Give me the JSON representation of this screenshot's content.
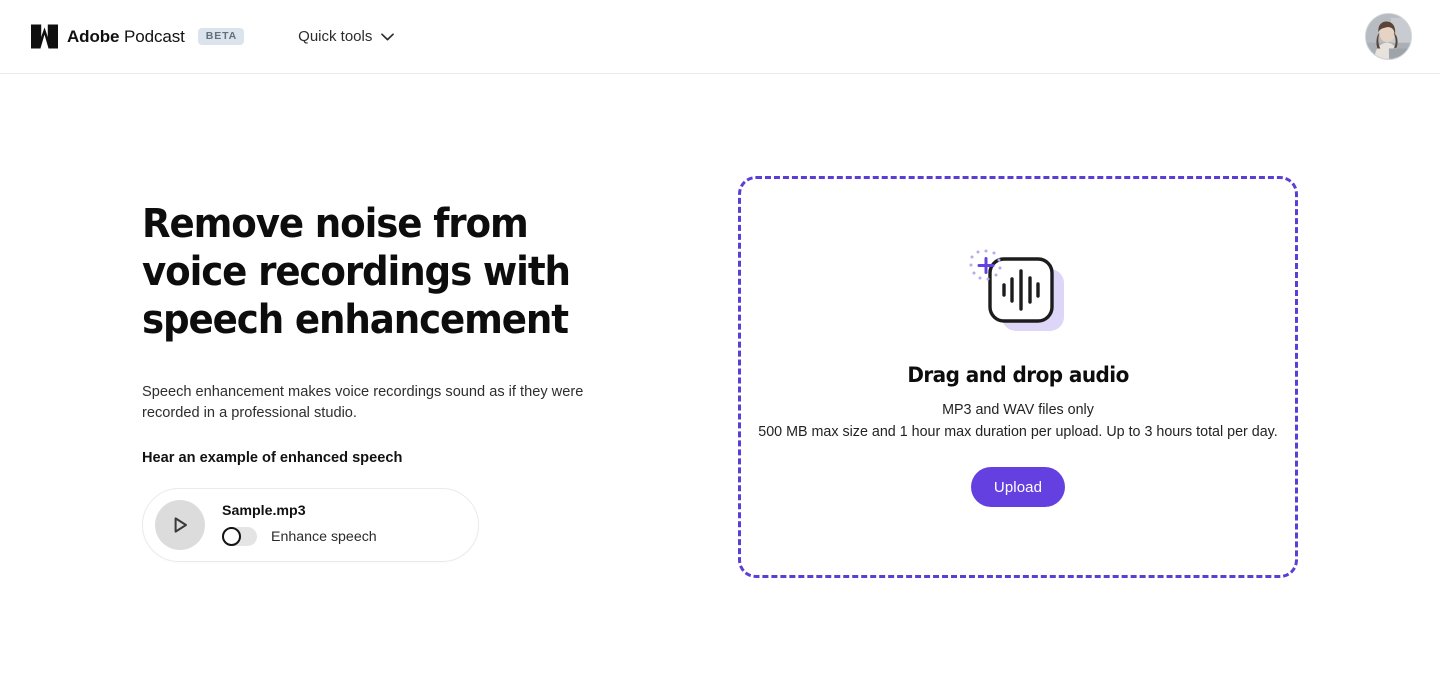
{
  "header": {
    "logo_icon": "adobe-a-logo",
    "brand_bold": "Adobe",
    "brand_regular": " Podcast",
    "beta_badge": "BETA",
    "quick_tools_label": "Quick tools",
    "chevron_icon": "chevron-down-icon",
    "avatar_icon": "user-avatar-photo"
  },
  "hero": {
    "headline": "Remove noise from\nvoice recordings with\nspeech enhancement",
    "subcopy": "Speech enhancement makes voice recordings sound as if they were recorded in a professional studio.",
    "hear_example_label": "Hear an example of enhanced speech"
  },
  "sample_player": {
    "play_icon": "play-icon",
    "file_name": "Sample.mp3",
    "toggle_label": "Enhance speech",
    "toggle_state": "off"
  },
  "dropzone": {
    "icon": "audio-file-add-icon",
    "title": "Drag and drop audio",
    "sub_line_1": "MP3 and WAV files only",
    "sub_line_2": "500 MB max size and 1 hour max duration per upload. Up to 3 hours total per day.",
    "upload_label": "Upload"
  },
  "colors": {
    "accent_purple": "#6540e0",
    "dash_border": "#5b3ed6",
    "beta_bg": "#dbe3ec",
    "beta_text": "#62707d",
    "play_bg": "#dcdcdc"
  }
}
